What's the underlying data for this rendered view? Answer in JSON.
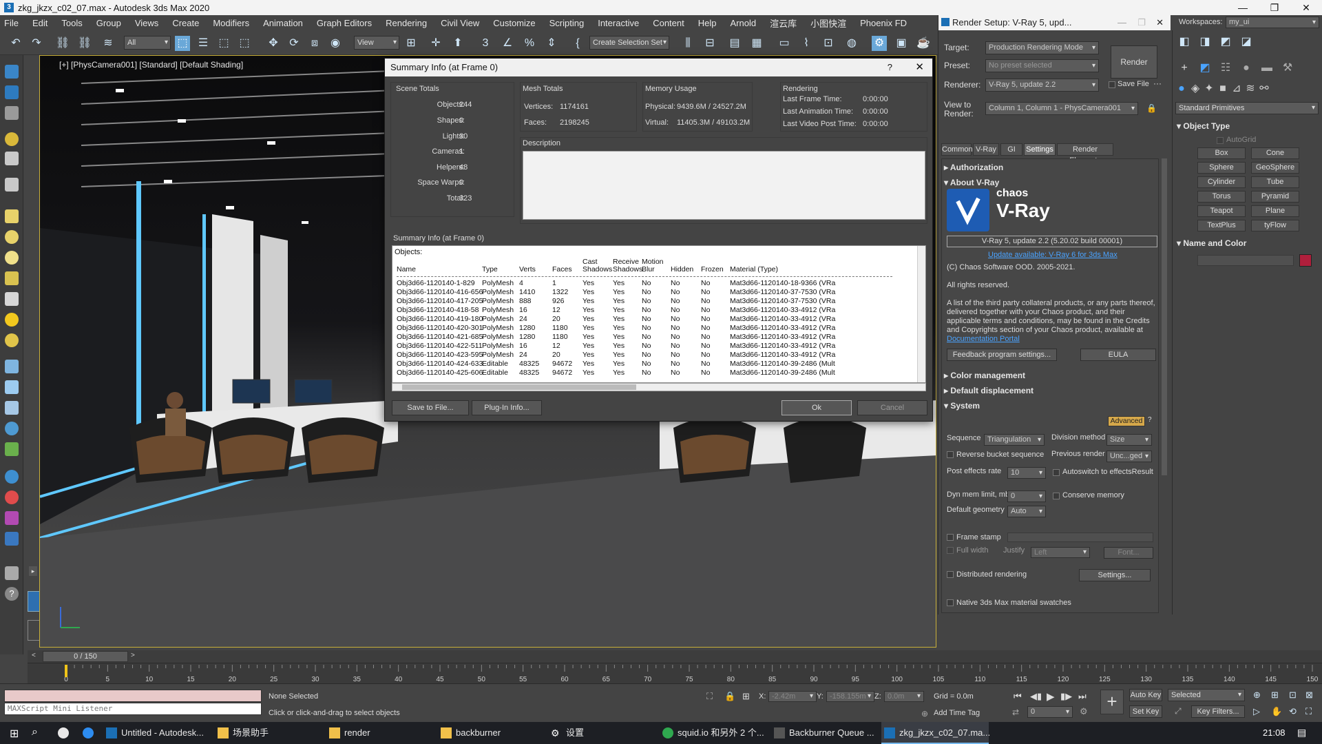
{
  "window": {
    "title": "zkg_jkzx_c02_07.max - Autodesk 3ds Max 2020"
  },
  "menu": [
    "File",
    "Edit",
    "Tools",
    "Group",
    "Views",
    "Create",
    "Modifiers",
    "Animation",
    "Graph Editors",
    "Rendering",
    "Civil View",
    "Customize",
    "Scripting",
    "Interactive",
    "Content",
    "Help",
    "Arnold",
    "渲云库",
    "小图快渲",
    "Phoenix FD"
  ],
  "toolbar": {
    "filter": "All",
    "view": "View",
    "selection_set": "Create Selection Set"
  },
  "viewport": {
    "label": "[+] [PhysCamera001] [Standard] [Default Shading]"
  },
  "summary": {
    "title": "Summary Info (at Frame 0)",
    "help": "?",
    "close": "✕",
    "scene_totals": {
      "title": "Scene Totals",
      "rows": [
        {
          "k": "Objects:",
          "v": "244"
        },
        {
          "k": "Shapes:",
          "v": "0"
        },
        {
          "k": "Lights:",
          "v": "30"
        },
        {
          "k": "Cameras:",
          "v": "1"
        },
        {
          "k": "Helpers:",
          "v": "48"
        },
        {
          "k": "Space Warps:",
          "v": "0"
        },
        {
          "k": "Total:",
          "v": "323"
        }
      ]
    },
    "mesh_totals": {
      "title": "Mesh Totals",
      "vertices_k": "Vertices:",
      "vertices": "1174161",
      "faces_k": "Faces:",
      "faces": "2198245"
    },
    "memory": {
      "title": "Memory Usage",
      "physical_k": "Physical:",
      "physical": "9439.6M / 24527.2M",
      "virtual_k": "Virtual:",
      "virtual": "11405.3M / 49103.2M"
    },
    "rendering": {
      "title": "Rendering",
      "rows": [
        {
          "k": "Last Frame Time:",
          "v": "0:00:00"
        },
        {
          "k": "Last Animation Time:",
          "v": "0:00:00"
        },
        {
          "k": "Last Video Post Time:",
          "v": "0:00:00"
        }
      ]
    },
    "description_label": "Description",
    "table_title": "Summary Info (at Frame 0)",
    "objects_label": "Objects:",
    "headers": [
      "Name",
      "Type",
      "Verts",
      "Faces",
      "Cast Shadows",
      "Receive Shadows",
      "Motion Blur",
      "Hidden",
      "Frozen",
      "Material (Type)"
    ],
    "rows": [
      [
        "Obj3d66-1120140-1-829",
        "PolyMesh",
        "4",
        "1",
        "Yes",
        "Yes",
        "No",
        "No",
        "No",
        "Mat3d66-1120140-18-9366 (VRa"
      ],
      [
        "Obj3d66-1120140-416-656",
        "PolyMesh",
        "1410",
        "1322",
        "Yes",
        "Yes",
        "No",
        "No",
        "No",
        "Mat3d66-1120140-37-7530 (VRa"
      ],
      [
        "Obj3d66-1120140-417-205",
        "PolyMesh",
        "888",
        "926",
        "Yes",
        "Yes",
        "No",
        "No",
        "No",
        "Mat3d66-1120140-37-7530 (VRa"
      ],
      [
        "Obj3d66-1120140-418-58",
        "PolyMesh",
        "16",
        "12",
        "Yes",
        "Yes",
        "No",
        "No",
        "No",
        "Mat3d66-1120140-33-4912 (VRa"
      ],
      [
        "Obj3d66-1120140-419-180",
        "PolyMesh",
        "24",
        "20",
        "Yes",
        "Yes",
        "No",
        "No",
        "No",
        "Mat3d66-1120140-33-4912 (VRa"
      ],
      [
        "Obj3d66-1120140-420-301",
        "PolyMesh",
        "1280",
        "1180",
        "Yes",
        "Yes",
        "No",
        "No",
        "No",
        "Mat3d66-1120140-33-4912 (VRa"
      ],
      [
        "Obj3d66-1120140-421-685",
        "PolyMesh",
        "1280",
        "1180",
        "Yes",
        "Yes",
        "No",
        "No",
        "No",
        "Mat3d66-1120140-33-4912 (VRa"
      ],
      [
        "Obj3d66-1120140-422-511",
        "PolyMesh",
        "16",
        "12",
        "Yes",
        "Yes",
        "No",
        "No",
        "No",
        "Mat3d66-1120140-33-4912 (VRa"
      ],
      [
        "Obj3d66-1120140-423-595",
        "PolyMesh",
        "24",
        "20",
        "Yes",
        "Yes",
        "No",
        "No",
        "No",
        "Mat3d66-1120140-33-4912 (VRa"
      ],
      [
        "Obj3d66-1120140-424-633",
        "Editable",
        "48325",
        "94672",
        "Yes",
        "Yes",
        "No",
        "No",
        "No",
        "Mat3d66-1120140-39-2486 (Mult"
      ],
      [
        "Obj3d66-1120140-425-606",
        "Editable",
        "48325",
        "94672",
        "Yes",
        "Yes",
        "No",
        "No",
        "No",
        "Mat3d66-1120140-39-2486 (Mult"
      ]
    ],
    "buttons": {
      "save": "Save to File...",
      "plugin": "Plug-In Info...",
      "ok": "Ok",
      "cancel": "Cancel"
    }
  },
  "render_setup": {
    "title": "Render Setup: V-Ray 5, upd...",
    "target_k": "Target:",
    "target": "Production Rendering Mode",
    "preset_k": "Preset:",
    "preset": "No preset selected",
    "renderer_k": "Renderer:",
    "renderer": "V-Ray 5, update 2.2",
    "save_file": "Save File",
    "view_k": "View to Render:",
    "view": "Column 1, Column 1 - PhysCamera001",
    "render_btn": "Render",
    "tabs": [
      "Common",
      "V-Ray",
      "GI",
      "Settings",
      "Render Elements"
    ],
    "authorization": "Authorization",
    "about": "About V-Ray",
    "brand_top": "chaos",
    "brand": "V-Ray",
    "version": "V-Ray 5, update 2.2 (5.20.02 build 00001)",
    "update_link": "Update available: V-Ray 6 for 3ds Max",
    "copyright": "(C) Chaos Software OOD. 2005-2021.",
    "rights": "All rights reserved.",
    "third_party": "A list of the third party collateral products, or any parts thereof, delivered together with your Chaos product, and their applicable terms and conditions, may be found in the Credits and Copyrights section of your Chaos product, available at",
    "doc_link": "Documentation Portal",
    "feedback_btn": "Feedback program settings...",
    "eula_btn": "EULA",
    "color_mgmt": "Color management",
    "default_disp": "Default displacement",
    "system": "System",
    "advanced": "Advanced",
    "sequence_k": "Sequence",
    "sequence": "Triangulation",
    "division_k": "Division method",
    "division": "Size",
    "reverse": "Reverse bucket sequence",
    "prev_render_k": "Previous render",
    "prev_render": "Unc...ged",
    "post_effects_k": "Post effects rate",
    "post_effects": "10",
    "autoswitch": "Autoswitch to effectsResult",
    "dyn_mem_k": "Dyn mem limit, mb",
    "dyn_mem": "0",
    "conserve": "Conserve memory",
    "def_geom_k": "Default geometry",
    "def_geom": "Auto",
    "frame_stamp": "Frame stamp",
    "full_width": "Full width",
    "justify_k": "Justify",
    "justify": "Left",
    "font_btn": "Font...",
    "distributed": "Distributed rendering",
    "settings_btn": "Settings...",
    "native": "Native 3ds Max material swatches"
  },
  "command_panel": {
    "workspace_k": "Workspaces:",
    "workspace": "my_ui",
    "category": "Standard Primitives",
    "object_type": "Object Type",
    "autogrid": "AutoGrid",
    "objects": [
      "Box",
      "Cone",
      "Sphere",
      "GeoSphere",
      "Cylinder",
      "Tube",
      "Torus",
      "Pyramid",
      "Teapot",
      "Plane",
      "TextPlus",
      "tyFlow"
    ],
    "name_color": "Name and Color",
    "swatch": "#b01f3c"
  },
  "timeline": {
    "frame": "0 / 150",
    "ticks": [
      "0",
      "5",
      "10",
      "15",
      "20",
      "25",
      "30",
      "35",
      "40",
      "45",
      "50",
      "55",
      "60",
      "65",
      "70",
      "75",
      "80",
      "85",
      "90",
      "95",
      "100",
      "105",
      "110",
      "115",
      "120",
      "125",
      "130",
      "135",
      "140",
      "145",
      "150"
    ]
  },
  "status": {
    "listener": "MAXScript Mini Listener",
    "selection": "None Selected",
    "hint": "Click or click-and-drag to select objects",
    "x_k": "X:",
    "x": "-2.42m",
    "y_k": "Y:",
    "y": "-158.155m",
    "z_k": "Z:",
    "z": "0.0m",
    "grid": "Grid = 0.0m",
    "add_tag": "Add Time Tag",
    "auto_key": "Auto Key",
    "set_key": "Set Key",
    "selected": "Selected",
    "key_filters": "Key Filters...",
    "frame_field": "0"
  },
  "taskbar": {
    "items": [
      "Untitled - Autodesk...",
      "场景助手",
      "render",
      "backburner",
      "设置",
      "squid.io 和另外 2 个...",
      "Backburner Queue ...",
      "zkg_jkzx_c02_07.ma..."
    ],
    "time": "21:08"
  }
}
